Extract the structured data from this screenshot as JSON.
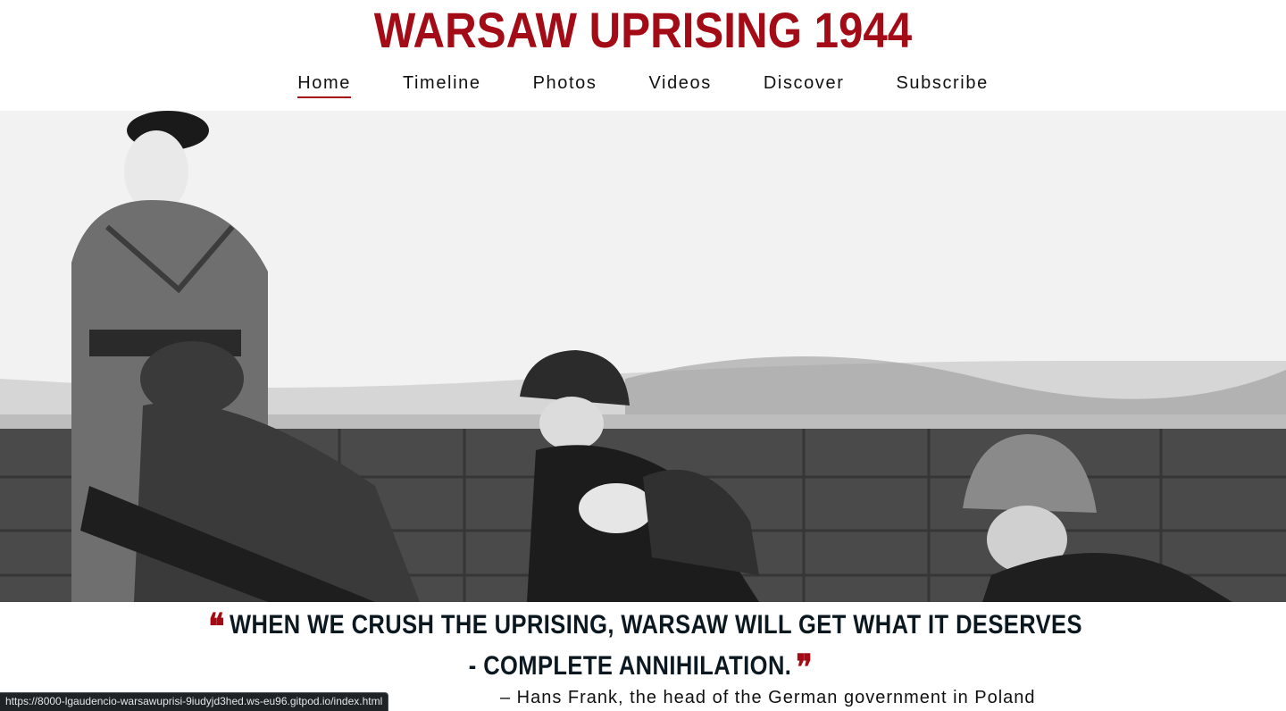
{
  "header": {
    "title": "WARSAW UPRISING 1944"
  },
  "nav": {
    "items": [
      {
        "label": "Home",
        "active": true
      },
      {
        "label": "Timeline",
        "active": false
      },
      {
        "label": "Photos",
        "active": false
      },
      {
        "label": "Videos",
        "active": false
      },
      {
        "label": "Discover",
        "active": false
      },
      {
        "label": "Subscribe",
        "active": false
      }
    ]
  },
  "hero": {
    "image": "black-and-white-photo-of-insurgent-soldiers-with-helmets-behind-wall"
  },
  "quote": {
    "open_mark": "❝",
    "line1": "WHEN WE CRUSH THE UPRISING, WARSAW WILL GET WHAT IT DESERVES",
    "line2": "- COMPLETE ANNIHILATION.",
    "close_mark": "❞",
    "attribution": "– Hans Frank, the head of the German government in Poland"
  },
  "status_bar": {
    "url": "https://8000-lgaudencio-warsawuprisi-9iudyjd3hed.ws-eu96.gitpod.io/index.html"
  },
  "colors": {
    "accent": "#a30c16",
    "text": "#111111",
    "quote_text": "#0c1820"
  }
}
